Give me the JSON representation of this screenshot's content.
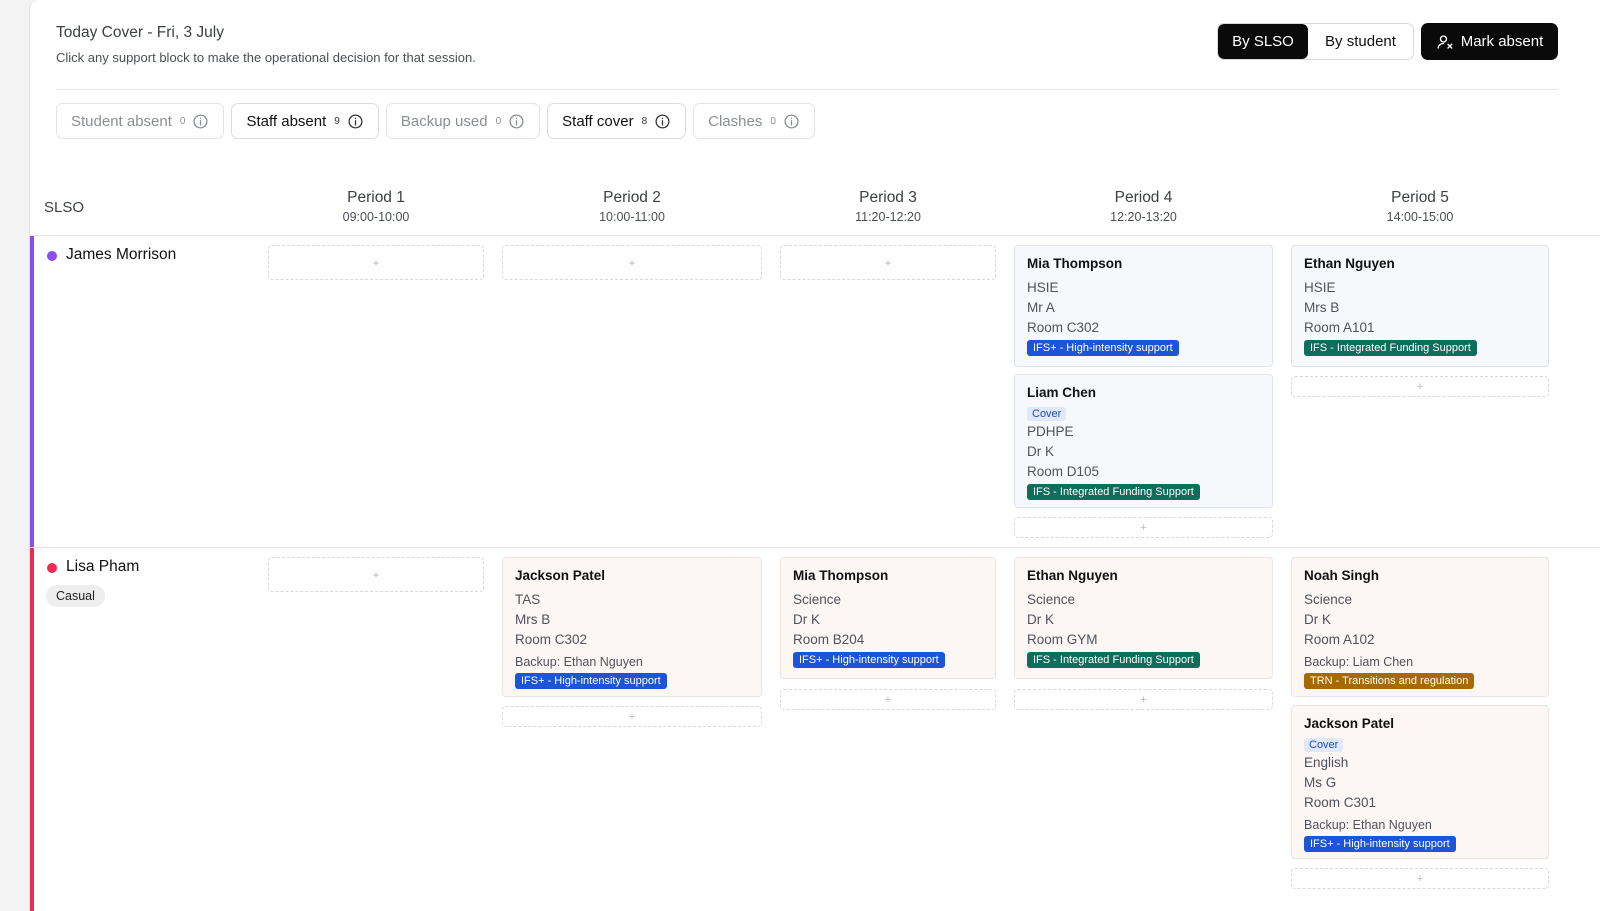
{
  "header": {
    "title": "Today Cover - Fri, 3 July",
    "subtitle": "Click any support block to make the operational decision for that session.",
    "view_toggle": [
      "By SLSO",
      "By student"
    ],
    "mark_absent": "Mark absent"
  },
  "filters": [
    {
      "label": "Student absent",
      "count": "0"
    },
    {
      "label": "Staff absent",
      "count": "9"
    },
    {
      "label": "Backup used",
      "count": "0"
    },
    {
      "label": "Staff cover",
      "count": "8"
    },
    {
      "label": "Clashes",
      "count": "0"
    }
  ],
  "grid": {
    "slso_header": "SLSO",
    "periods": [
      {
        "name": "Period 1",
        "time": "09:00-10:00"
      },
      {
        "name": "Period 2",
        "time": "10:00-11:00"
      },
      {
        "name": "Period 3",
        "time": "11:20-12:20"
      },
      {
        "name": "Period 4",
        "time": "12:20-13:20"
      },
      {
        "name": "Period 5",
        "time": "14:00-15:00"
      }
    ],
    "add_symbol": "+"
  },
  "staff": [
    {
      "name": "James Morrison",
      "color": "#8b4cf0",
      "badge": ""
    },
    {
      "name": "Lisa Pham",
      "color": "#ee2a55",
      "badge": "Casual"
    }
  ],
  "cards": {
    "jm_p4_a": {
      "student": "Mia Thompson",
      "subject": "HSIE",
      "teacher": "Mr A",
      "room": "Room C302",
      "tag": "IFS+ - High-intensity support"
    },
    "jm_p4_b": {
      "student": "Liam Chen",
      "cover": "Cover",
      "subject": "PDHPE",
      "teacher": "Dr K",
      "room": "Room D105",
      "tag": "IFS - Integrated Funding Support"
    },
    "jm_p5_a": {
      "student": "Ethan Nguyen",
      "subject": "HSIE",
      "teacher": "Mrs B",
      "room": "Room A101",
      "tag": "IFS - Integrated Funding Support"
    },
    "lp_p2_a": {
      "student": "Jackson Patel",
      "subject": "TAS",
      "teacher": "Mrs B",
      "room": "Room C302",
      "backup": "Backup: Ethan Nguyen",
      "tag": "IFS+ - High-intensity support"
    },
    "lp_p3_a": {
      "student": "Mia Thompson",
      "subject": "Science",
      "teacher": "Dr K",
      "room": "Room B204",
      "tag": "IFS+ - High-intensity support"
    },
    "lp_p4_a": {
      "student": "Ethan Nguyen",
      "subject": "Science",
      "teacher": "Dr K",
      "room": "Room GYM",
      "tag": "IFS - Integrated Funding Support"
    },
    "lp_p5_a": {
      "student": "Noah Singh",
      "subject": "Science",
      "teacher": "Dr K",
      "room": "Room A102",
      "backup": "Backup: Liam Chen",
      "tag": "TRN - Transitions and regulation"
    },
    "lp_p5_b": {
      "student": "Jackson Patel",
      "cover": "Cover",
      "subject": "English",
      "teacher": "Ms G",
      "room": "Room C301",
      "backup": "Backup: Ethan Nguyen",
      "tag": "IFS+ - High-intensity support"
    }
  },
  "colors": {
    "tag_ifs_plus": "#1d55d8",
    "tag_ifs": "#0d6e5c",
    "tag_trn": "#a66a00"
  }
}
